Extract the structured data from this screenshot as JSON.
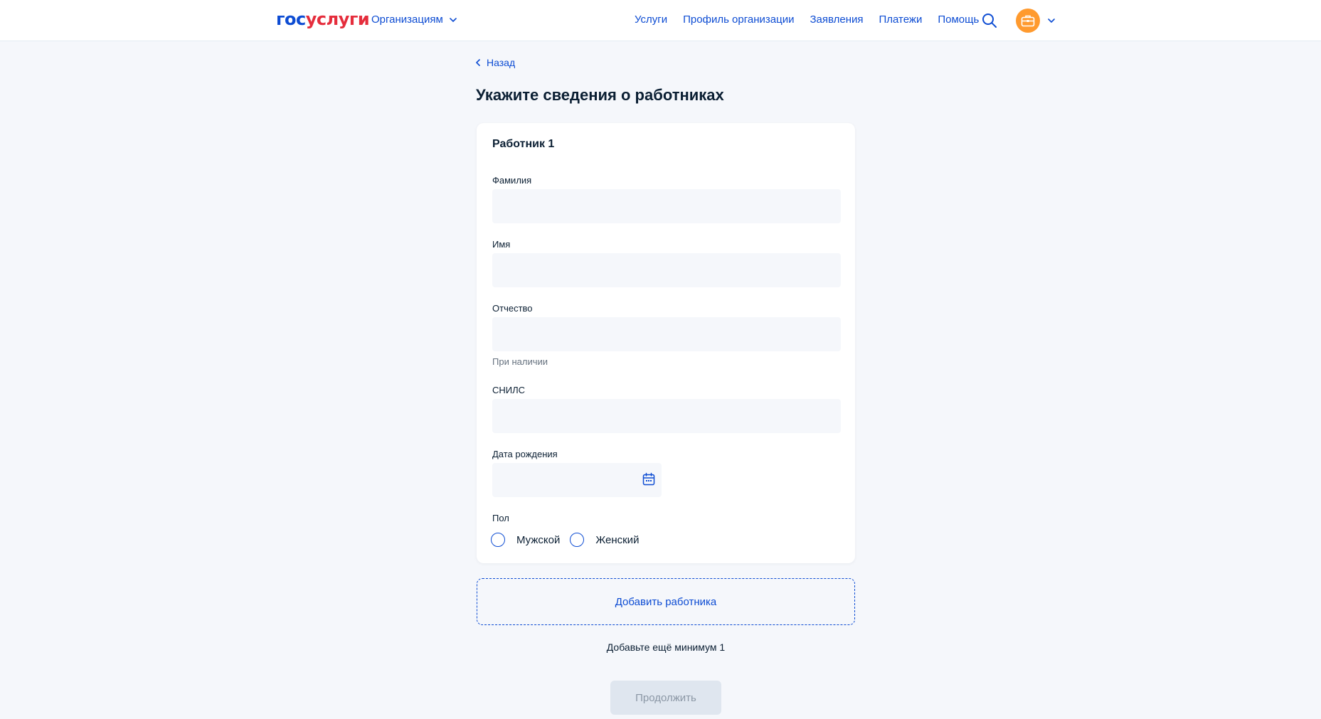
{
  "header": {
    "logo_part1": "гос",
    "logo_part2": "услуги",
    "org_switch_label": "Организациям",
    "nav": [
      "Услуги",
      "Профиль организации",
      "Заявления",
      "Платежи",
      "Помощь"
    ]
  },
  "back_label": "Назад",
  "page_title": "Укажите сведения о работниках",
  "worker": {
    "title": "Работник 1",
    "fields": {
      "last_name": {
        "label": "Фамилия",
        "value": ""
      },
      "first_name": {
        "label": "Имя",
        "value": ""
      },
      "patronymic": {
        "label": "Отчество",
        "value": "",
        "hint": "При наличии"
      },
      "snils": {
        "label": "СНИЛС",
        "value": ""
      },
      "birth_date": {
        "label": "Дата рождения",
        "value": ""
      }
    },
    "gender": {
      "label": "Пол",
      "options": [
        "Мужской",
        "Женский"
      ],
      "selected": ""
    }
  },
  "add_worker_label": "Добавить работника",
  "min_note": "Добавьте ещё минимум 1",
  "continue_label": "Продолжить",
  "colors": {
    "accent": "#0d4cd3",
    "logo_red": "#e52d3c",
    "avatar": "#ff9a2e",
    "page_bg": "#f5f7fb",
    "disabled_button": "#dfe6ef"
  },
  "icons": [
    "chevron-down-icon",
    "search-icon",
    "briefcase-icon",
    "chevron-left-icon",
    "calendar-icon"
  ]
}
